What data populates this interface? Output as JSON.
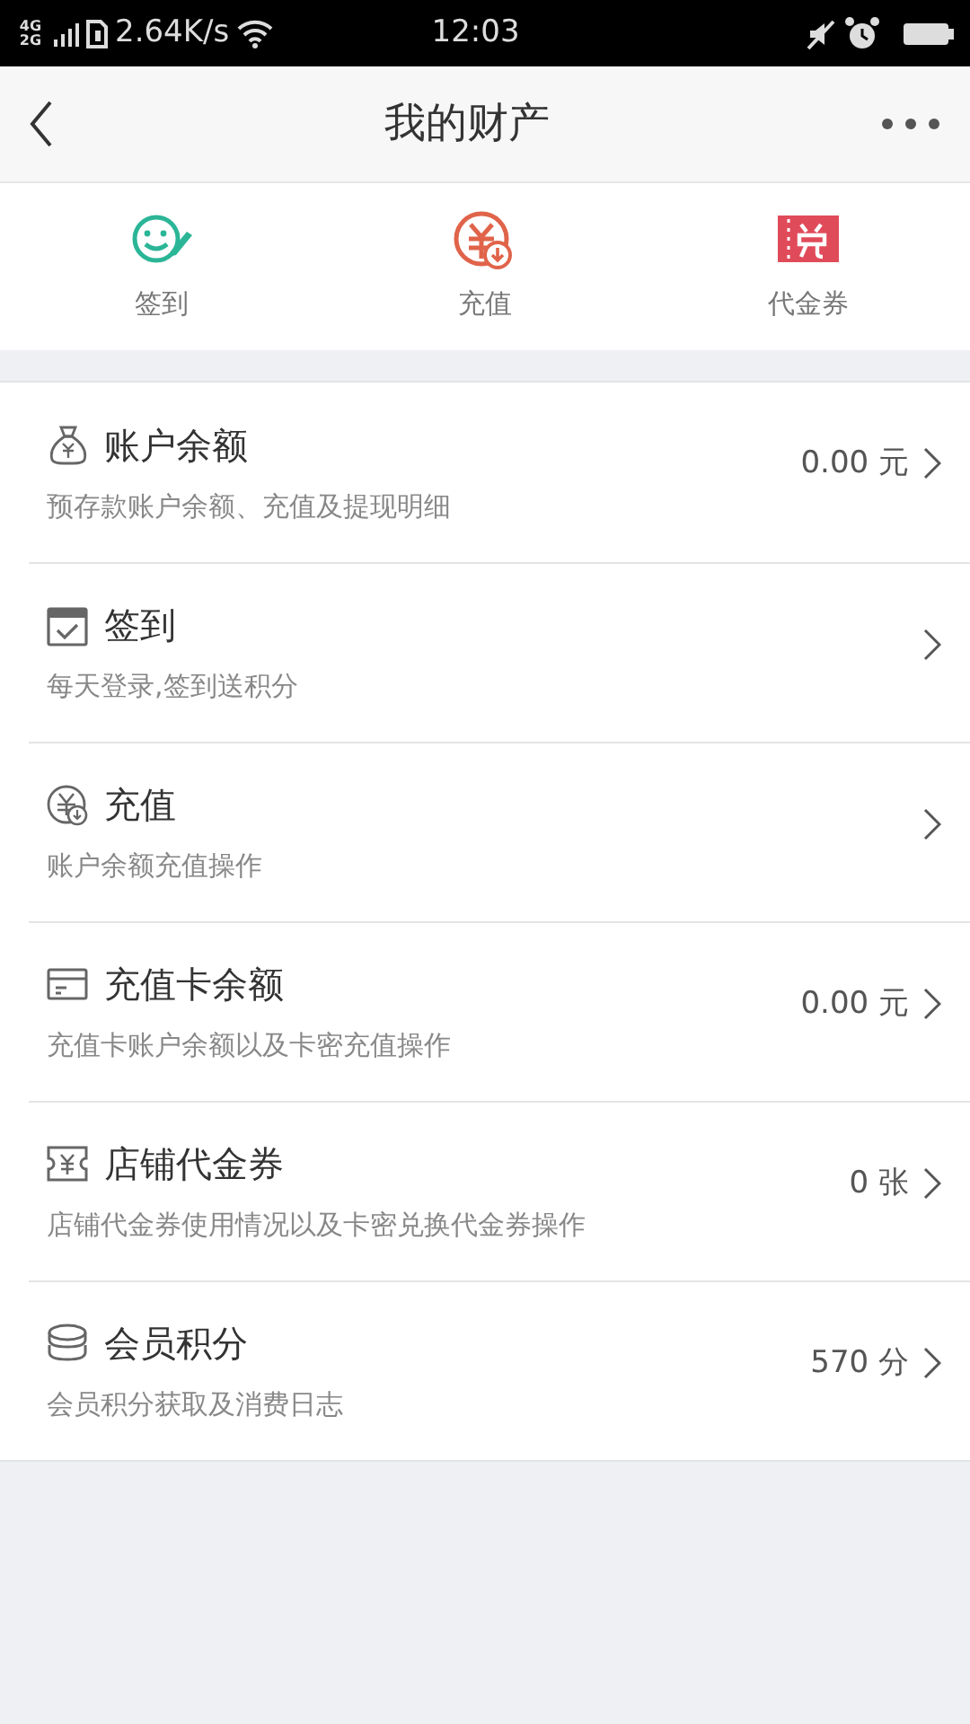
{
  "status_bar": {
    "network": "4G 2G",
    "speed": "2.64K/s",
    "time": "12:03"
  },
  "header": {
    "title": "我的财产"
  },
  "quick_actions": [
    {
      "label": "签到"
    },
    {
      "label": "充值"
    },
    {
      "label": "代金券"
    }
  ],
  "items": [
    {
      "title": "账户余额",
      "subtitle": "预存款账户余额、充值及提现明细",
      "value": "0.00 元"
    },
    {
      "title": "签到",
      "subtitle": "每天登录,签到送积分"
    },
    {
      "title": "充值",
      "subtitle": "账户余额充值操作"
    },
    {
      "title": "充值卡余额",
      "subtitle": "充值卡账户余额以及卡密充值操作",
      "value": "0.00 元"
    },
    {
      "title": "店铺代金券",
      "subtitle": "店铺代金券使用情况以及卡密兑换代金券操作",
      "value": "0 张"
    },
    {
      "title": "会员积分",
      "subtitle": "会员积分获取及消费日志",
      "value": "570 分"
    }
  ]
}
